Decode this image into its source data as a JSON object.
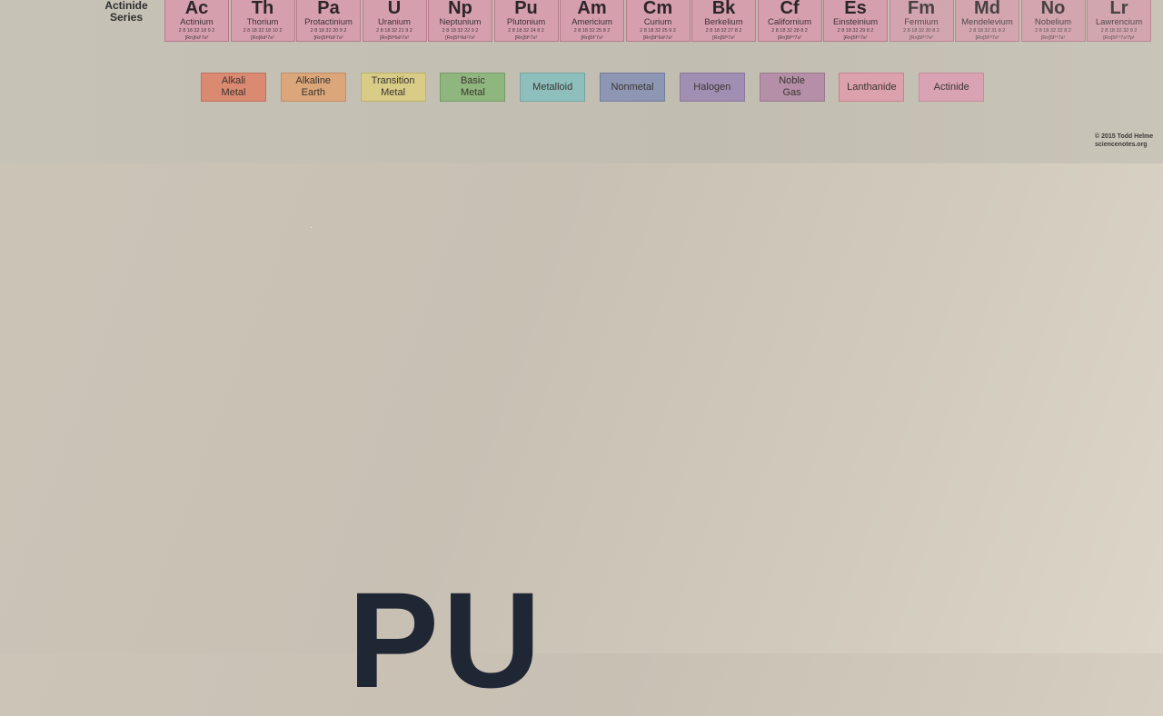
{
  "series_label": "Actinide\nSeries",
  "elements": [
    {
      "symbol": "Ac",
      "name": "Actinium",
      "shells": "2 8 18 32 18 9 2",
      "config": "[Rn]6d¹7s²"
    },
    {
      "symbol": "Th",
      "name": "Thorium",
      "shells": "2 8 18 32 18 10 2",
      "config": "[Rn]6d²7s²"
    },
    {
      "symbol": "Pa",
      "name": "Protactinium",
      "shells": "2 8 18 32 20 9 2",
      "config": "[Rn]5f²6d¹7s²"
    },
    {
      "symbol": "U",
      "name": "Uranium",
      "shells": "2 8 18 32 21 9 2",
      "config": "[Rn]5f³6d¹7s²"
    },
    {
      "symbol": "Np",
      "name": "Neptunium",
      "shells": "2 8 18 32 22 9 2",
      "config": "[Rn]5f⁴6d¹7s²"
    },
    {
      "symbol": "Pu",
      "name": "Plutonium",
      "shells": "2 8 18 32 24 8 2",
      "config": "[Rn]5f⁶7s²"
    },
    {
      "symbol": "Am",
      "name": "Americium",
      "shells": "2 8 18 32 25 8 2",
      "config": "[Rn]5f⁷7s²"
    },
    {
      "symbol": "Cm",
      "name": "Curium",
      "shells": "2 8 18 32 25 9 2",
      "config": "[Rn]5f⁷6d¹7s²"
    },
    {
      "symbol": "Bk",
      "name": "Berkelium",
      "shells": "2 8 18 32 27 8 2",
      "config": "[Rn]5f⁹7s²"
    },
    {
      "symbol": "Cf",
      "name": "Californium",
      "shells": "2 8 18 32 28 8 2",
      "config": "[Rn]5f¹⁰7s²"
    },
    {
      "symbol": "Es",
      "name": "Einsteinium",
      "shells": "2 8 18 32 29 8 2",
      "config": "[Rn]5f¹¹7s²"
    },
    {
      "symbol": "Fm",
      "name": "Fermium",
      "shells": "2 8 18 32 30 8 2",
      "config": "[Rn]5f¹²7s²"
    },
    {
      "symbol": "Md",
      "name": "Mendelevium",
      "shells": "2 8 18 32 31 8 2",
      "config": "[Rn]5f¹³7s²"
    },
    {
      "symbol": "No",
      "name": "Nobelium",
      "shells": "2 8 18 32 32 8 2",
      "config": "[Rn]5f¹⁴7s²"
    },
    {
      "symbol": "Lr",
      "name": "Lawrencium",
      "shells": "2 8 18 32 32 9 2",
      "config": "[Rn]5f¹⁴7s²7p¹"
    }
  ],
  "legend": [
    {
      "label": "Alkali\nMetal",
      "color": "#d98a70",
      "border": "#c0705a"
    },
    {
      "label": "Alkaline\nEarth",
      "color": "#dba679",
      "border": "#c58d60"
    },
    {
      "label": "Transition\nMetal",
      "color": "#d8cc86",
      "border": "#bfb36b"
    },
    {
      "label": "Basic\nMetal",
      "color": "#8fb67e",
      "border": "#739c63"
    },
    {
      "label": "Metalloid",
      "color": "#8ebfbc",
      "border": "#72a6a2"
    },
    {
      "label": "Nonmetal",
      "color": "#8d96b3",
      "border": "#737c9b"
    },
    {
      "label": "Halogen",
      "color": "#a18fb3",
      "border": "#8a779c"
    },
    {
      "label": "Noble\nGas",
      "color": "#b58fa8",
      "border": "#9c7690"
    },
    {
      "label": "Lanthanide",
      "color": "#dba1ad",
      "border": "#cc7f90"
    },
    {
      "label": "Actinide",
      "color": "#d9a3b3",
      "border": "#c58c9d"
    }
  ],
  "credit": {
    "line1": "© 2015 Todd Helme",
    "line2": "sciencenotes.org"
  },
  "big_text": "PU",
  "colors": {
    "actinide": "#d59fae",
    "background": "#c8c0b3"
  }
}
